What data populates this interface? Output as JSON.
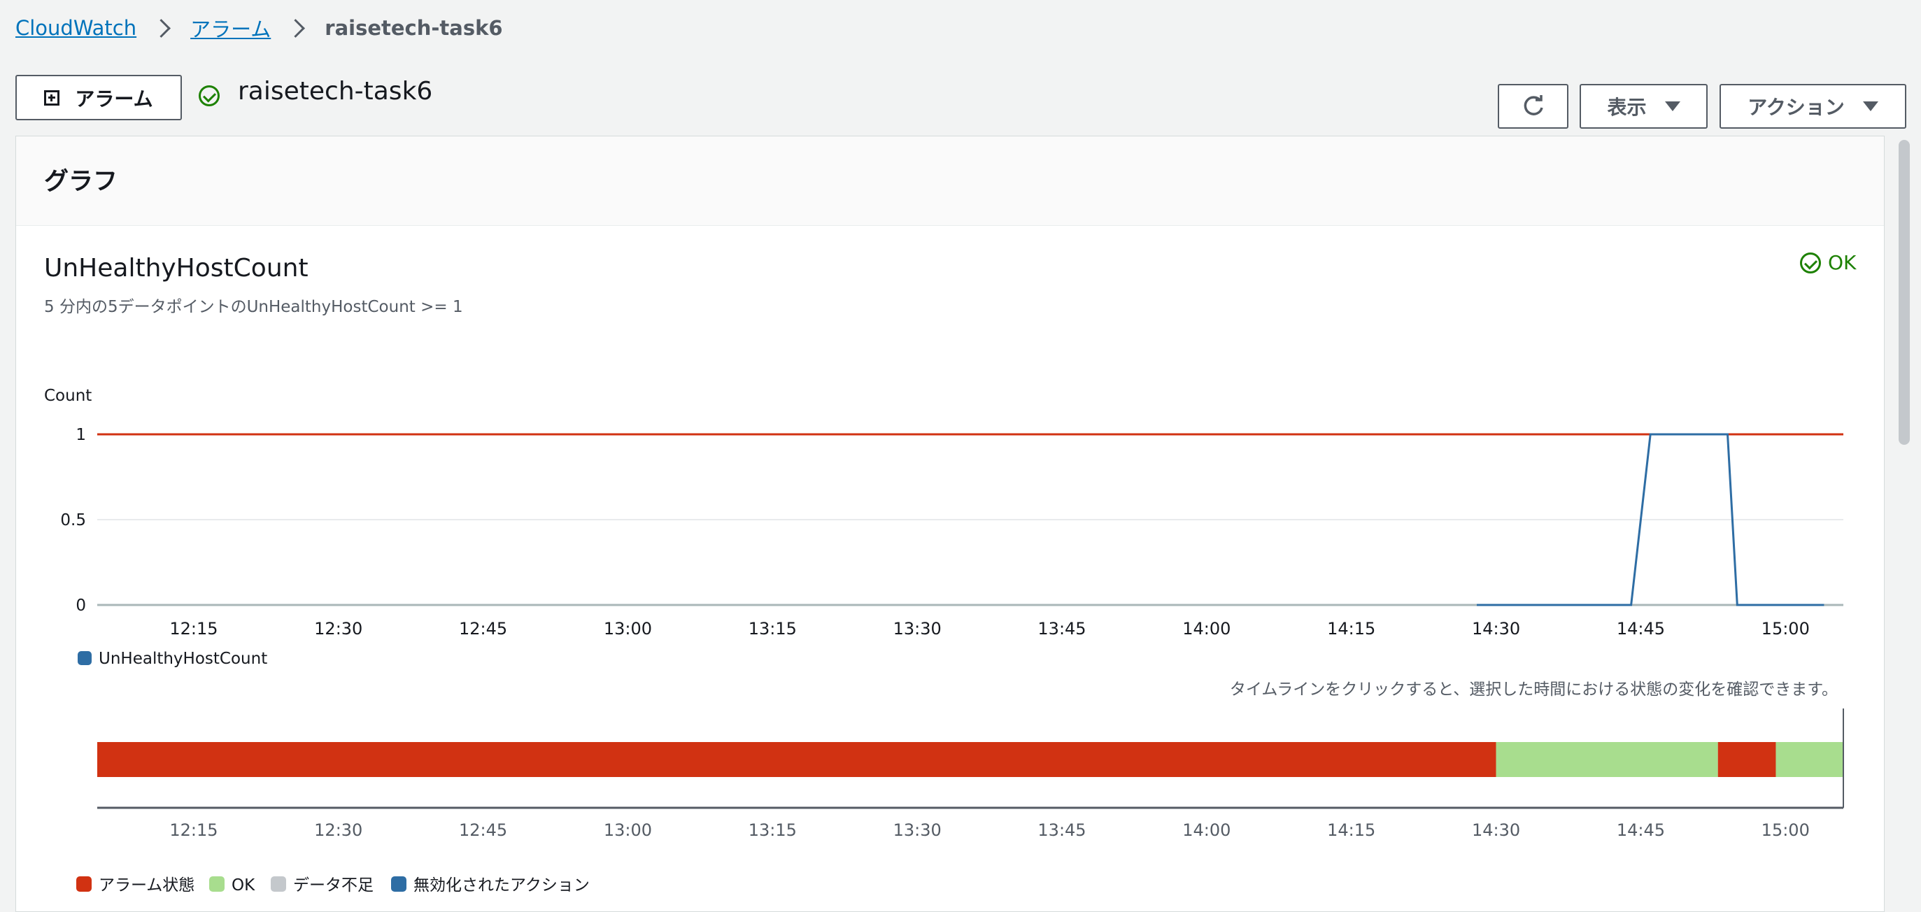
{
  "breadcrumb": {
    "items": [
      "CloudWatch",
      "アラーム"
    ],
    "current": "raisetech-task6"
  },
  "header": {
    "alarm_button_label": "アラーム",
    "title": "raisetech-task6",
    "status": "ok",
    "refresh_icon": "refresh-icon",
    "view_button_label": "表示",
    "actions_button_label": "アクション"
  },
  "panel": {
    "heading": "グラフ",
    "chart_title": "UnHealthyHostCount",
    "chart_subtitle": "5 分内の5データポイントのUnHealthyHostCount >= 1",
    "status_label": "OK"
  },
  "timeline": {
    "hint": "タイムラインをクリックすると、選択した時間における状態の変化を確認できます。",
    "legend": [
      {
        "label": "アラーム状態",
        "color": "#d13212"
      },
      {
        "label": "OK",
        "color": "#a8dd8e"
      },
      {
        "label": "データ不足",
        "color": "#c4c8cc"
      },
      {
        "label": "無効化されたアクション",
        "color": "#2e6da4"
      }
    ],
    "segments": [
      {
        "state": "alarm",
        "from": "12:05",
        "to": "14:30"
      },
      {
        "state": "ok",
        "from": "14:30",
        "to": "14:53"
      },
      {
        "state": "alarm",
        "from": "14:53",
        "to": "14:59"
      },
      {
        "state": "ok",
        "from": "14:59",
        "to": "15:06"
      }
    ],
    "ticks": [
      "12:15",
      "12:30",
      "12:45",
      "13:00",
      "13:15",
      "13:30",
      "13:45",
      "14:00",
      "14:15",
      "14:30",
      "14:45",
      "15:00"
    ]
  },
  "chart_data": {
    "type": "line",
    "ylabel": "Count",
    "xlabel": "",
    "ylim": [
      0,
      1
    ],
    "yticks": [
      "1",
      "0.5",
      "0"
    ],
    "xticks": [
      "12:15",
      "12:30",
      "12:45",
      "13:00",
      "13:15",
      "13:30",
      "13:45",
      "14:00",
      "14:15",
      "14:30",
      "14:45",
      "15:00"
    ],
    "xlim": [
      "12:05",
      "15:06"
    ],
    "threshold": {
      "value": 1,
      "color": "#d13212"
    },
    "series": [
      {
        "name": "UnHealthyHostCount",
        "color": "#2e6da4",
        "x": [
          "14:28",
          "14:44",
          "14:46",
          "14:54",
          "14:55",
          "15:04"
        ],
        "values": [
          0,
          0,
          1,
          1,
          0,
          0
        ]
      }
    ],
    "legend_position": "bottom-left"
  }
}
